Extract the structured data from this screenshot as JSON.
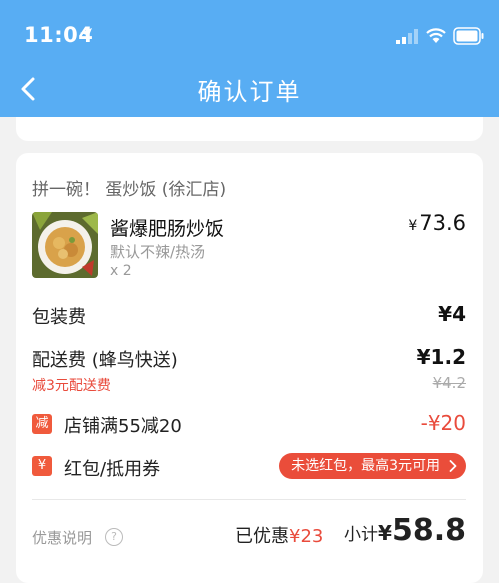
{
  "status_bar": {
    "time": "11:04"
  },
  "header": {
    "title": "确认订单"
  },
  "order": {
    "shop_name": "拼一碗！ 蛋炒饭 (徐汇店)",
    "item": {
      "name": "酱爆肥肠炒饭",
      "spec": "默认不辣/热汤",
      "qty": "x 2",
      "currency": "¥",
      "price": "73.6"
    },
    "packaging": {
      "label": "包装费",
      "value": "¥4"
    },
    "delivery": {
      "label": "配送费 (蜂鸟快送)",
      "value": "¥1.2",
      "discount_note": "减3元配送费",
      "original": "¥4.2"
    },
    "shop_promo": {
      "tag": "减",
      "label": "店铺满55减20",
      "value": "-¥20"
    },
    "coupon": {
      "tag": "¥",
      "label": "红包/抵用券",
      "pill": "未选红包，最高3元可用"
    },
    "footer": {
      "promo_help": "优惠说明",
      "help_icon": "?",
      "saved_label": "已优惠",
      "saved_amount": "¥23",
      "subtotal_label": "小计",
      "subtotal_currency": "¥",
      "subtotal_amount": "58.8"
    }
  },
  "colors": {
    "header_bg": "#58adf3",
    "accent_red": "#ea4d3a",
    "background": "#f2f2f2"
  }
}
